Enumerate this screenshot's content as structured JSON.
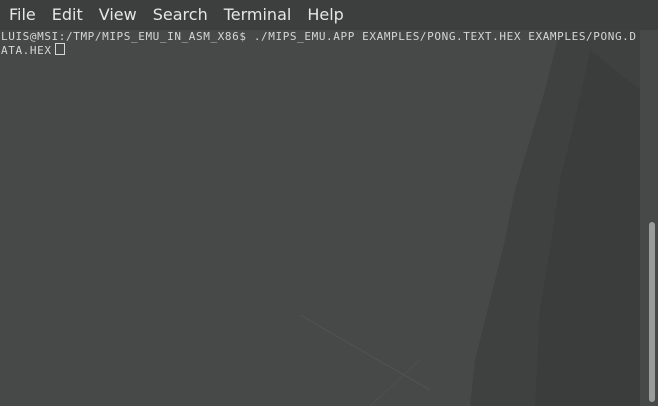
{
  "menu": {
    "items": [
      "File",
      "Edit",
      "View",
      "Search",
      "Terminal",
      "Help"
    ]
  },
  "terminal": {
    "prompt": "luis@msi:/tmp/mips_emu_in_asm_x86$",
    "command": "./mips_emu.app examples/pong.text.hex examples/pong.data.hex"
  },
  "colors": {
    "menubar_bg": "#3d3f3e",
    "terminal_bg": "#474948",
    "text": "#d6d6d6"
  }
}
